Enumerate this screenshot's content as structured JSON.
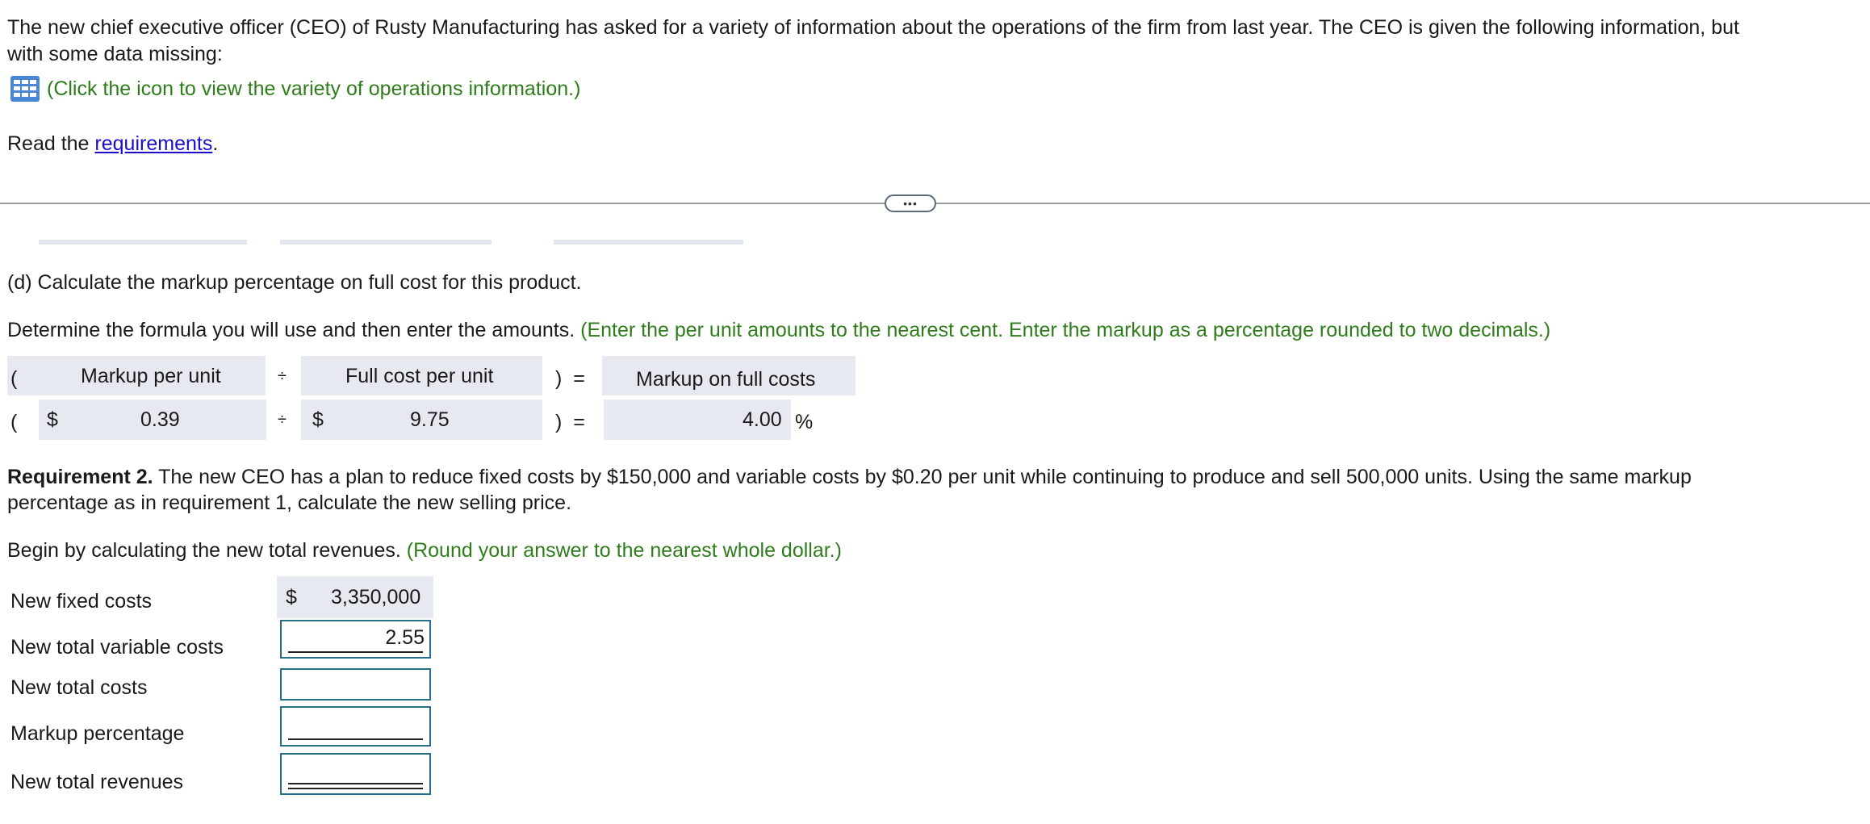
{
  "intro": {
    "line1": "The new chief executive officer (CEO) of Rusty Manufacturing has asked for a variety of information about the operations of the firm from last year. The CEO is given the following information, but",
    "line2": "with some data missing:",
    "icon_link_text": "(Click the icon to view the variety of operations information.)",
    "read_prefix": "Read the ",
    "requirements_link": "requirements",
    "read_suffix": "."
  },
  "divider": {
    "handle": "•••"
  },
  "part_d": {
    "heading": "(d) Calculate the markup percentage on full cost for this product.",
    "instruction": "Determine the formula you will use and then enter the amounts.",
    "instruction_hint": "(Enter the per unit amounts to the nearest cent. Enter the markup as a percentage rounded to two decimals.)",
    "header": {
      "open_paren": "(",
      "col1": "Markup per unit",
      "divide": "÷",
      "col2": "Full cost per unit",
      "close_eq": ")  =",
      "col3": "Markup on full costs"
    },
    "row": {
      "open_paren": "(",
      "dollar1": "$",
      "value1": "0.39",
      "divide": "÷",
      "dollar2": "$",
      "value2": "9.75",
      "close_eq": ")  =",
      "value3": "4.00",
      "percent": "%"
    }
  },
  "req2": {
    "label": "Requirement 2.",
    "text1": " The new CEO has a plan to reduce fixed costs by $150,000 and variable costs by $0.20 per unit while continuing to produce and sell 500,000 units. Using the same markup",
    "text2": "percentage as in requirement 1, calculate the new selling price.",
    "begin": "Begin by calculating the new total revenues.",
    "begin_hint": "(Round your answer to the nearest whole dollar.)"
  },
  "table": {
    "rows": [
      {
        "label": "New fixed costs",
        "dollar": "$",
        "value": "3,350,000"
      },
      {
        "label": "New total variable costs",
        "value": "2.55"
      },
      {
        "label": "New total costs",
        "value": ""
      },
      {
        "label": "Markup percentage",
        "value": ""
      },
      {
        "label": "New total revenues",
        "value": ""
      }
    ]
  }
}
